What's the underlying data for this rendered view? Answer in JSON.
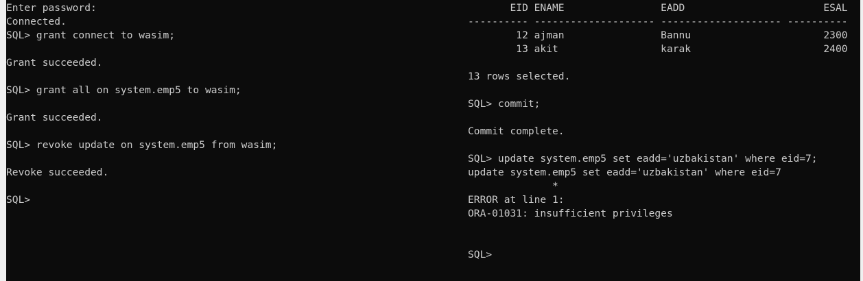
{
  "left_terminal": {
    "lines": [
      "Enter password:",
      "Connected.",
      "SQL> grant connect to wasim;",
      "",
      "Grant succeeded.",
      "",
      "SQL> grant all on system.emp5 to wasim;",
      "",
      "Grant succeeded.",
      "",
      "SQL> revoke update on system.emp5 from wasim;",
      "",
      "Revoke succeeded.",
      "",
      "SQL>"
    ]
  },
  "right_terminal": {
    "lines": [
      "       EID ENAME                EADD                       ESAL",
      "---------- -------------------- -------------------- ----------",
      "        12 ajman                Bannu                      2300",
      "        13 akit                 karak                      2400",
      "",
      "13 rows selected.",
      "",
      "SQL> commit;",
      "",
      "Commit complete.",
      "",
      "SQL> update system.emp5 set eadd='uzbakistan' where eid=7;",
      "update system.emp5 set eadd='uzbakistan' where eid=7",
      "              *",
      "ERROR at line 1:",
      "ORA-01031: insufficient privileges",
      "",
      "",
      "SQL>"
    ]
  }
}
